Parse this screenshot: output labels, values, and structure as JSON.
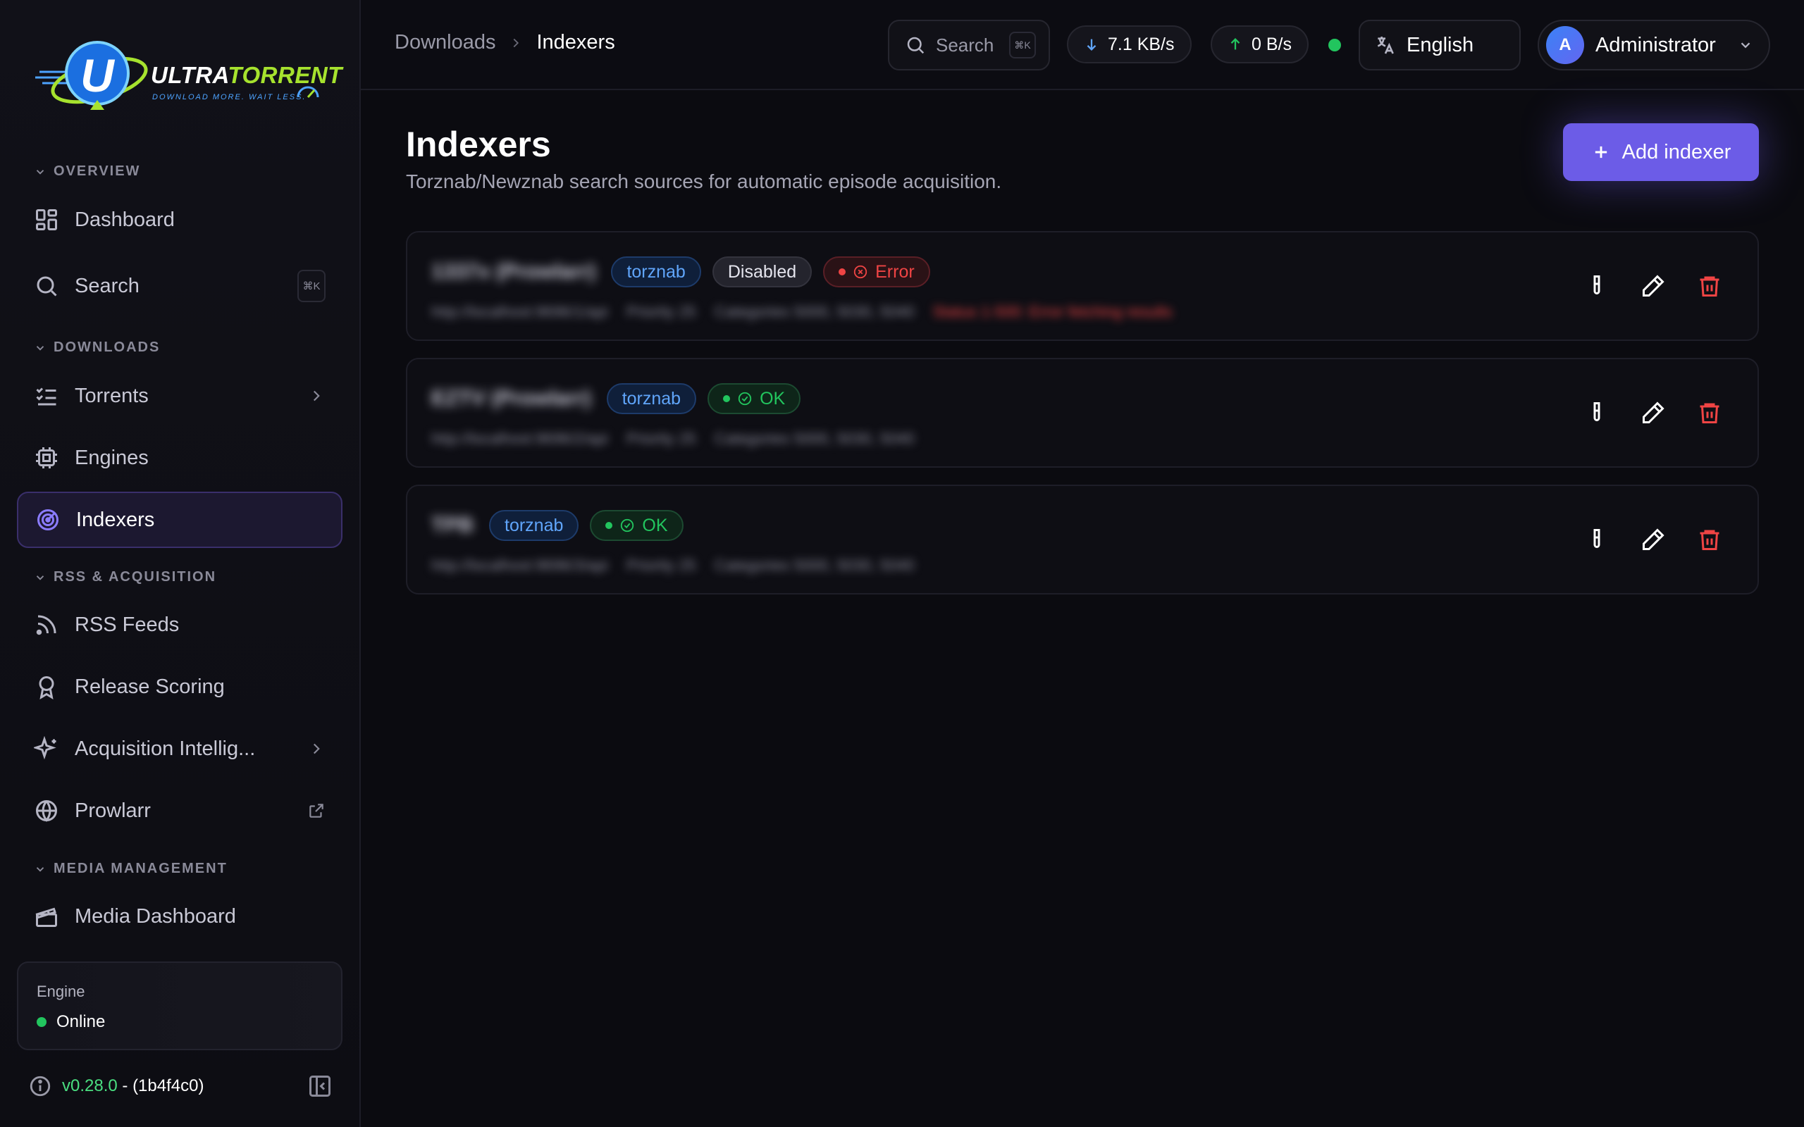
{
  "brand": {
    "name_main": "ULTRA",
    "name_accent": "TORRENT",
    "tagline": "DOWNLOAD MORE. WAIT LESS."
  },
  "sidebar": {
    "sections": {
      "overview": "OVERVIEW",
      "downloads": "DOWNLOADS",
      "rss": "RSS & ACQUISITION",
      "media": "MEDIA MANAGEMENT"
    },
    "items": {
      "dashboard": "Dashboard",
      "search": "Search",
      "search_shortcut": "⌘K",
      "torrents": "Torrents",
      "engines": "Engines",
      "indexers": "Indexers",
      "rss_feeds": "RSS Feeds",
      "release_scoring": "Release Scoring",
      "acquisition": "Acquisition Intellig...",
      "prowlarr": "Prowlarr",
      "media_dashboard": "Media Dashboard"
    },
    "engine": {
      "label": "Engine",
      "status": "Online"
    },
    "version": {
      "number": "v0.28.0",
      "build": "- (1b4f4c0)"
    }
  },
  "header": {
    "breadcrumb": {
      "parent": "Downloads",
      "current": "Indexers"
    },
    "search": {
      "placeholder": "Search",
      "shortcut": "⌘K"
    },
    "download_speed": "7.1 KB/s",
    "upload_speed": "0 B/s",
    "language": "English",
    "user": {
      "initial": "A",
      "name": "Administrator"
    }
  },
  "page": {
    "title": "Indexers",
    "subtitle": "Torznab/Newznab search sources for automatic episode acquisition.",
    "add_button": "Add indexer"
  },
  "indexers": [
    {
      "name": "1337x (Prowlarr)",
      "protocol": "torznab",
      "disabled_badge": "Disabled",
      "status": "Error",
      "details": [
        "http://localhost:9696/1/api",
        "Priority 25",
        "Categories 5000, 5030, 5040"
      ],
      "error_text": "Status 1-500: Error fetching results"
    },
    {
      "name": "EZTV (Prowlarr)",
      "protocol": "torznab",
      "status": "OK",
      "details": [
        "http://localhost:9696/2/api",
        "Priority 25",
        "Categories 5000, 5030, 5040"
      ]
    },
    {
      "name": "TPB",
      "protocol": "torznab",
      "status": "OK",
      "details": [
        "http://localhost:9696/3/api",
        "Priority 25",
        "Categories 5000, 5030, 5040"
      ]
    }
  ],
  "colors": {
    "accent": "#6c5ce7",
    "ok": "#22c55e",
    "error": "#ef4444",
    "protocol": "#60a5fa"
  }
}
